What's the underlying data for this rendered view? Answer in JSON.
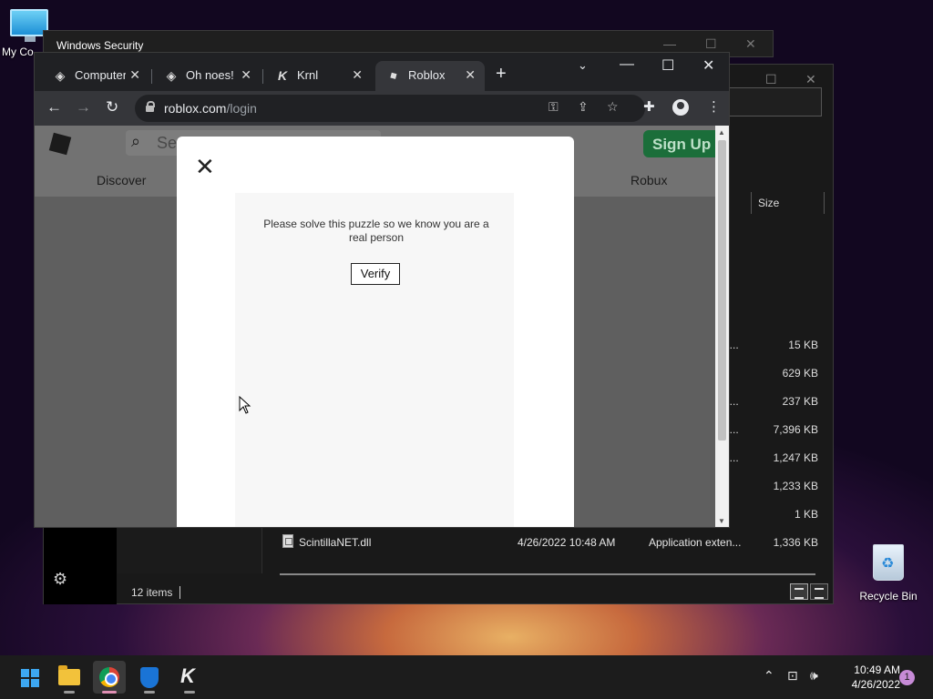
{
  "desktop": {
    "icons": [
      {
        "label": "My Co"
      },
      {
        "label": "Recycle Bin"
      }
    ]
  },
  "windows_security": {
    "title": "Windows Security"
  },
  "explorer": {
    "column_size": "Size",
    "files": [
      {
        "name": "",
        "date": "",
        "type_truncated": "n...",
        "size": "15 KB"
      },
      {
        "name": "",
        "date": "",
        "type_truncated": "",
        "size": "629 KB"
      },
      {
        "name": "",
        "date": "",
        "type_truncated": "n...",
        "size": "237 KB"
      },
      {
        "name": "",
        "date": "",
        "type_truncated": "n...",
        "size": "7,396 KB"
      },
      {
        "name": "",
        "date": "",
        "type_truncated": "n...",
        "size": "1,247 KB"
      },
      {
        "name": "",
        "date": "",
        "type_truncated": "",
        "size": "1,233 KB"
      },
      {
        "name": "",
        "date": "",
        "type_truncated": "",
        "size": "1 KB"
      }
    ],
    "last_file": {
      "name": "ScintillaNET.dll",
      "date": "4/26/2022 10:48 AM",
      "type": "Application exten...",
      "size": "1,336 KB"
    },
    "status_items": "12 items"
  },
  "chrome": {
    "tabs": [
      {
        "label": "Computer",
        "icon": "roblox-studio-icon",
        "active": false
      },
      {
        "label": "Oh noes!",
        "icon": "roblox-studio-icon",
        "active": false
      },
      {
        "label": "Krnl",
        "icon": "krnl-icon",
        "active": false
      },
      {
        "label": "Roblox",
        "icon": "roblox-icon",
        "active": true
      }
    ],
    "url_host": "roblox.com",
    "url_path": "/login"
  },
  "roblox_page": {
    "search_placeholder": "Se",
    "signup_label": "Sign Up",
    "nav": [
      "Discover",
      "Robux"
    ]
  },
  "modal": {
    "close_glyph": "✕",
    "puzzle_message": "Please solve this puzzle so we know you are a real person",
    "verify_label": "Verify"
  },
  "taskbar": {
    "time": "10:49 AM",
    "date": "4/26/2022",
    "notification_count": "1"
  },
  "colors": {
    "signup_green": "#1b6e3a",
    "chrome_dark": "#202124",
    "windows_blue": "#3da7f1"
  }
}
